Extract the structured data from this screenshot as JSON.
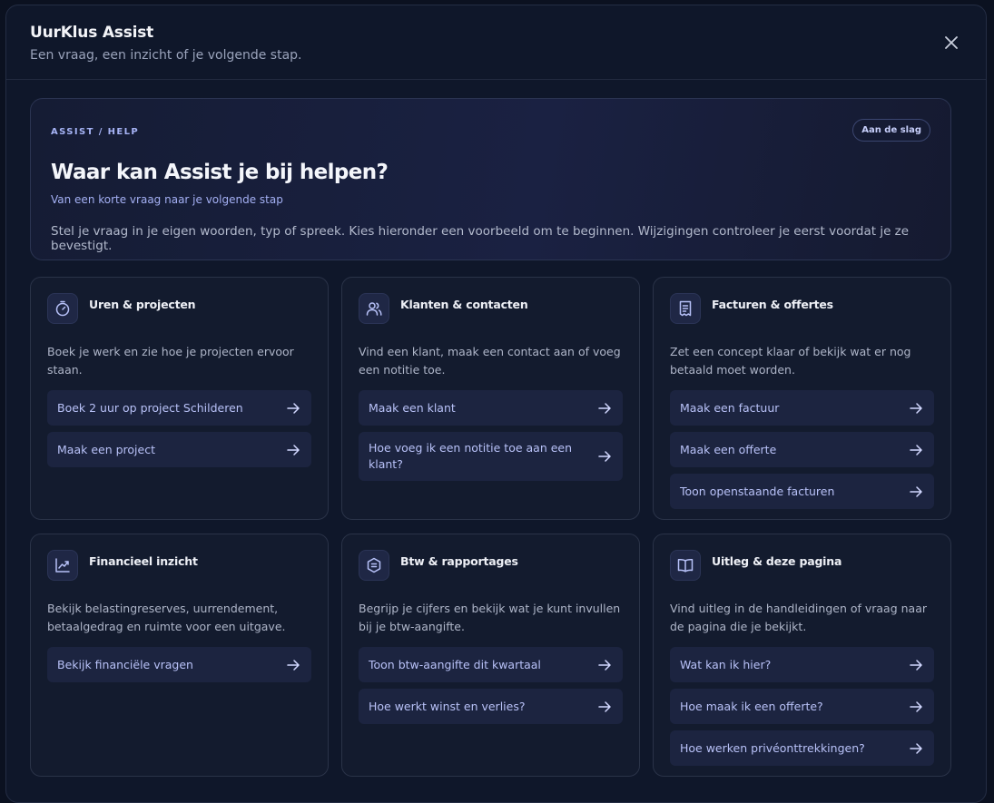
{
  "header": {
    "title": "UurKlus Assist",
    "subtitle": "Een vraag, een inzicht of je volgende stap."
  },
  "hero": {
    "eyebrow": "ASSIST / HELP",
    "badge": "Aan de slag",
    "title": "Waar kan Assist je bij helpen?",
    "subtitle": "Van een korte vraag naar je volgende stap",
    "body": "Stel je vraag in je eigen woorden, typ of spreek. Kies hieronder een voorbeeld om te beginnen. Wijzigingen controleer je eerst voordat je ze bevestigt."
  },
  "cards": [
    {
      "icon": "timer-icon",
      "title": "Uren & projecten",
      "description": "Boek je werk en zie hoe je projecten ervoor staan.",
      "actions": [
        "Boek 2 uur op project Schilderen",
        "Maak een project"
      ]
    },
    {
      "icon": "users-icon",
      "title": "Klanten & contacten",
      "description": "Vind een klant, maak een contact aan of voeg een notitie toe.",
      "actions": [
        "Maak een klant",
        "Hoe voeg ik een notitie toe aan een klant?"
      ]
    },
    {
      "icon": "receipt-icon",
      "title": "Facturen & offertes",
      "description": "Zet een concept klaar of bekijk wat er nog betaald moet worden.",
      "actions": [
        "Maak een factuur",
        "Maak een offerte",
        "Toon openstaande facturen"
      ]
    },
    {
      "icon": "trend-chart-icon",
      "title": "Financieel inzicht",
      "description": "Bekijk belastingreserves, uurrendement, betaalgedrag en ruimte voor een uitgave.",
      "actions": [
        "Bekijk financiële vragen"
      ]
    },
    {
      "icon": "tax-icon",
      "title": "Btw & rapportages",
      "description": "Begrijp je cijfers en bekijk wat je kunt invullen bij je btw-aangifte.",
      "actions": [
        "Toon btw-aangifte dit kwartaal",
        "Hoe werkt winst en verlies?"
      ]
    },
    {
      "icon": "book-icon",
      "title": "Uitleg & deze pagina",
      "description": "Vind uitleg in de handleidingen of vraag naar de pagina die je bekijkt.",
      "actions": [
        "Wat kan ik hier?",
        "Hoe maak ik een offerte?",
        "Hoe werken privéonttrekkingen?"
      ]
    }
  ]
}
